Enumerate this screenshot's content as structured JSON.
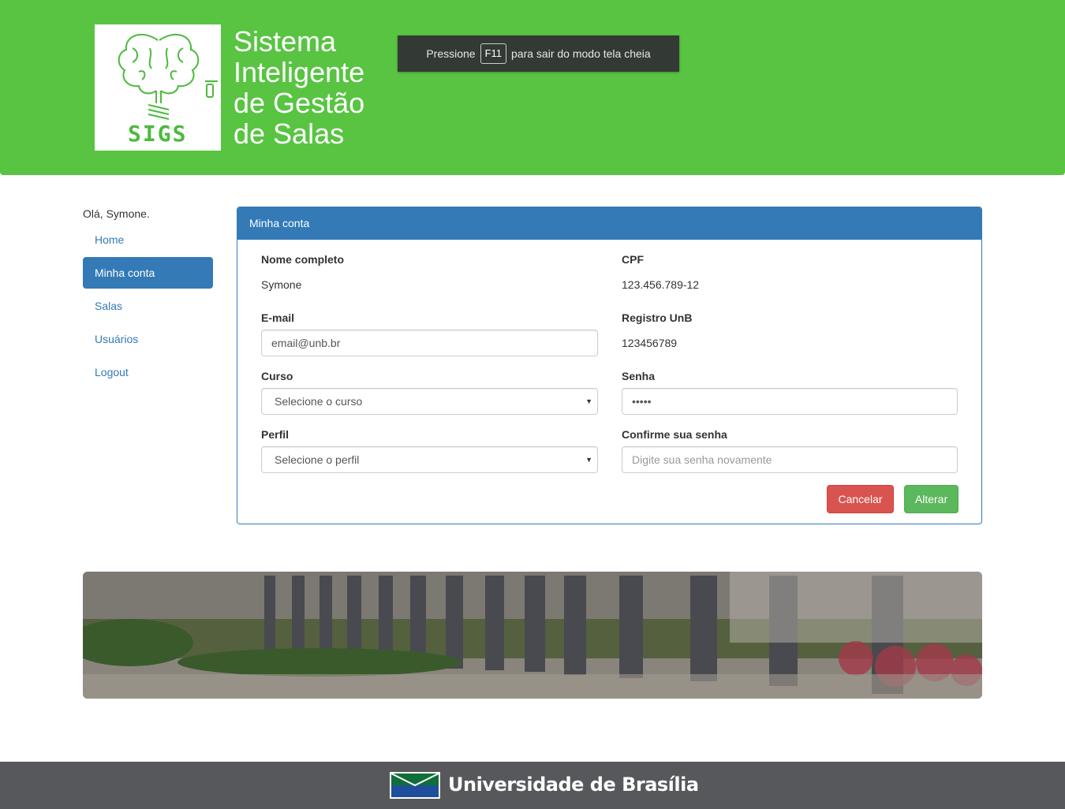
{
  "header": {
    "logo_text": "SIGS",
    "title_lines": [
      "Sistema",
      "Inteligente",
      "de Gestão",
      "de Salas"
    ],
    "fullscreen_prefix": "Pressione",
    "fullscreen_key": "F11",
    "fullscreen_suffix": "para sair do modo tela cheia"
  },
  "sidebar": {
    "greeting": "Olá, Symone.",
    "items": [
      {
        "label": "Home"
      },
      {
        "label": "Minha conta",
        "active": true
      },
      {
        "label": "Salas"
      },
      {
        "label": "Usuários"
      },
      {
        "label": "Logout"
      }
    ]
  },
  "panel": {
    "title": "Minha conta",
    "fields": {
      "nome_label": "Nome completo",
      "nome_value": "Symone",
      "cpf_label": "CPF",
      "cpf_value": "123.456.789-12",
      "email_label": "E-mail",
      "email_value": "email@unb.br",
      "registro_label": "Registro UnB",
      "registro_value": "123456789",
      "curso_label": "Curso",
      "curso_selected": "Selecione o curso",
      "senha_label": "Senha",
      "senha_value": "•••••",
      "perfil_label": "Perfil",
      "perfil_selected": "Selecione o perfil",
      "confirm_label": "Confirme sua senha",
      "confirm_placeholder": "Digite sua senha novamente"
    },
    "cancel_label": "Cancelar",
    "save_label": "Alterar"
  },
  "footer": {
    "university": "Universidade de Brasília"
  },
  "colors": {
    "header_green": "#58c442",
    "primary_blue": "#337ab7",
    "danger_red": "#d9534f",
    "success_green": "#5cb85c",
    "footer_gray": "#57585b"
  }
}
